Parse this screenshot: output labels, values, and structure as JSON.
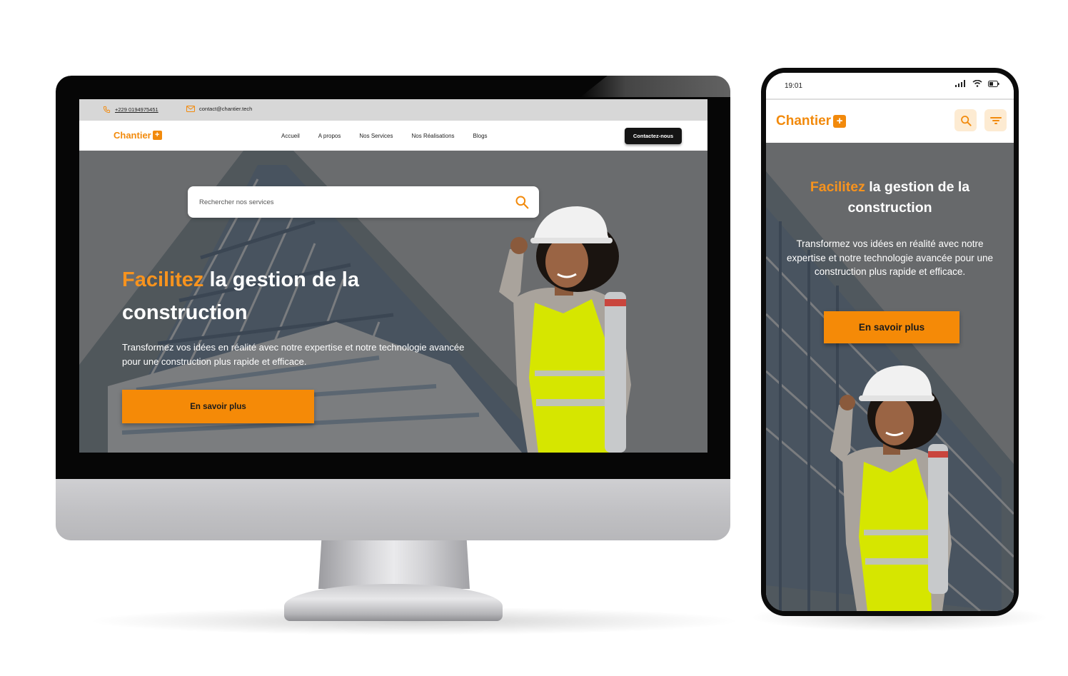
{
  "colors": {
    "brand_orange": "#f28a0c",
    "button_orange": "#f58a07",
    "headline_orange": "#f7931e",
    "dark_cta": "#141414",
    "hero_gray": "#6c6d6f"
  },
  "desktop": {
    "topbar": {
      "phone": "+229 0194975451",
      "email": "contact@chantier.tech",
      "phone_icon": "phone-icon",
      "email_icon": "mail-icon"
    },
    "nav": {
      "logo": "Chantier",
      "logo_mark": "+",
      "menu": [
        "Accueil",
        "A propos",
        "Nos Services",
        "Nos Réalisations",
        "Blogs"
      ],
      "cta": "Contactez-nous"
    },
    "hero": {
      "search_placeholder": "Rechercher nos services",
      "headline_accent": "Facilitez",
      "headline_line1_rest": " la gestion de la",
      "headline_line2": "construction",
      "subtitle": "Transformez vos idées en réalité avec notre expertise et notre technologie avancée pour une construction plus rapide et efficace.",
      "button": "En savoir plus"
    }
  },
  "mobile": {
    "status": {
      "time": "19:01"
    },
    "nav": {
      "logo": "Chantier",
      "logo_mark": "+",
      "search_icon": "search-icon",
      "filter_icon": "filter-icon"
    },
    "hero": {
      "headline_accent": "Facilitez",
      "headline_rest": " la gestion de la",
      "headline_line2": "construction",
      "subtitle": "Transformez vos idées en réalité avec notre expertise et notre technologie avancée pour une construction plus rapide et efficace.",
      "button": "En savoir plus"
    }
  }
}
